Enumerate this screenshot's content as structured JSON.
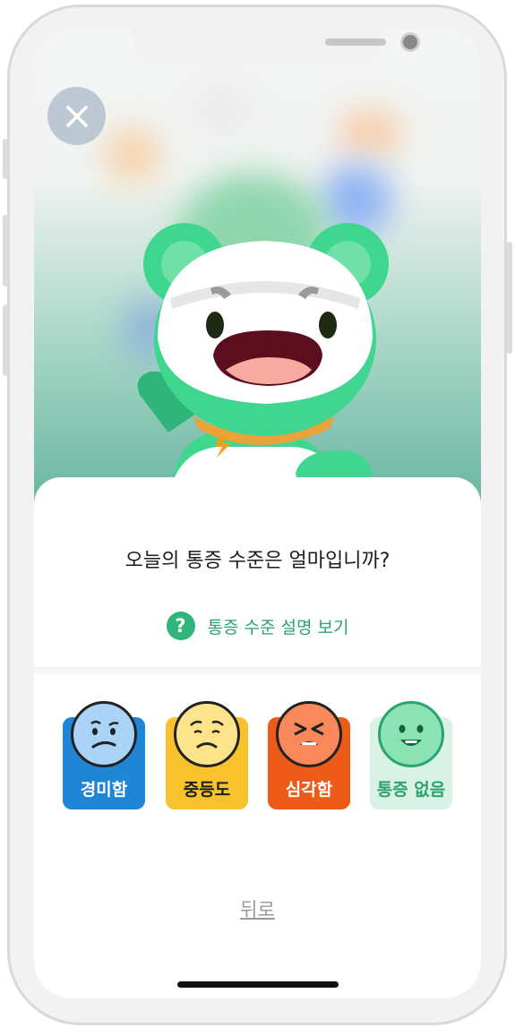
{
  "modal": {
    "question": "오늘의 통증 수준은 얼마입니까?",
    "help_link": "통증 수준 설명 보기",
    "help_icon_glyph": "?",
    "back_link": "뒤로"
  },
  "pain_levels": [
    {
      "label": "경미함",
      "color": "#1f86d6",
      "face_color": "#a9d3f7",
      "text_color": "#ffffff",
      "face": "worried"
    },
    {
      "label": "중등도",
      "color": "#f7c22b",
      "face_color": "#fde48a",
      "text_color": "#1e1e1e",
      "face": "uncomfortable"
    },
    {
      "label": "심각함",
      "color": "#ee5a17",
      "face_color": "#f9895a",
      "text_color": "#ffffff",
      "face": "distressed"
    },
    {
      "label": "통증 없음",
      "color": "#d8f2e5",
      "face_color": "#8be3b4",
      "text_color": "#2aa36d",
      "face": "smiling"
    }
  ],
  "colors": {
    "accent": "#2fb47a",
    "mascot": "#3fd68f"
  },
  "icons": [
    "close-icon",
    "help-icon",
    "bolt-icon"
  ]
}
